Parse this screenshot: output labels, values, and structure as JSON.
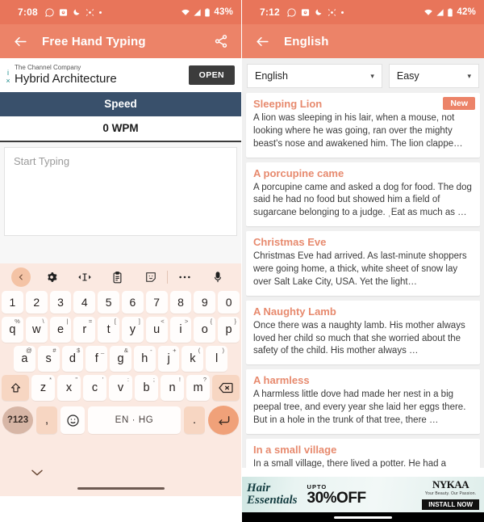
{
  "left": {
    "status": {
      "time": "7:08",
      "battery": "43%",
      "icons": [
        "whatsapp-icon",
        "camera-icon",
        "moon-dnd-icon",
        "location-icon",
        "dot-icon"
      ],
      "right_icons": [
        "wifi-icon",
        "signal-icon",
        "battery-icon"
      ]
    },
    "appbar": {
      "title": "Free Hand Typing",
      "back": "back-arrow",
      "share": "share-icon"
    },
    "ad": {
      "advertiser": "The Channel Company",
      "headline": "Hybrid Architecture",
      "cta": "OPEN",
      "info": "i",
      "close": "×"
    },
    "speed": {
      "label": "Speed",
      "value": "0 WPM"
    },
    "editor": {
      "placeholder": "Start Typing",
      "value": ""
    },
    "keyboard": {
      "tools": [
        "chevron-left-icon",
        "gear-icon",
        "text-cursor-icon",
        "clipboard-icon",
        "sticker-icon",
        "more-icon",
        "mic-icon"
      ],
      "row_numbers": [
        "1",
        "2",
        "3",
        "4",
        "5",
        "6",
        "7",
        "8",
        "9",
        "0"
      ],
      "row_q": [
        {
          "k": "q",
          "s": "%"
        },
        {
          "k": "w",
          "s": "\\"
        },
        {
          "k": "e",
          "s": "|"
        },
        {
          "k": "r",
          "s": "="
        },
        {
          "k": "t",
          "s": "["
        },
        {
          "k": "y",
          "s": "]"
        },
        {
          "k": "u",
          "s": "<"
        },
        {
          "k": "i",
          "s": ">"
        },
        {
          "k": "o",
          "s": "{"
        },
        {
          "k": "p",
          "s": "}"
        }
      ],
      "row_a": [
        {
          "k": "a",
          "s": "@"
        },
        {
          "k": "s",
          "s": "#"
        },
        {
          "k": "d",
          "s": "$"
        },
        {
          "k": "f",
          "s": "_"
        },
        {
          "k": "g",
          "s": "&"
        },
        {
          "k": "h",
          "s": "-"
        },
        {
          "k": "j",
          "s": "+"
        },
        {
          "k": "k",
          "s": "("
        },
        {
          "k": "l",
          "s": ")"
        }
      ],
      "row_z": [
        {
          "k": "z",
          "s": "*"
        },
        {
          "k": "x",
          "s": "\""
        },
        {
          "k": "c",
          "s": "'"
        },
        {
          "k": "v",
          "s": ":"
        },
        {
          "k": "b",
          "s": ";"
        },
        {
          "k": "n",
          "s": "!"
        },
        {
          "k": "m",
          "s": "?"
        }
      ],
      "shift": "shift-icon",
      "backspace": "backspace-icon",
      "sym": "?123",
      "comma": ",",
      "emoji": "emoji-icon",
      "space": "EN · HG",
      "period": ".",
      "enter": "enter-icon",
      "collapse": "chevron-down-icon"
    }
  },
  "right": {
    "status": {
      "time": "7:12",
      "battery": "42%",
      "icons": [
        "whatsapp-icon",
        "camera-icon",
        "moon-dnd-icon",
        "location-icon",
        "dot-icon"
      ],
      "right_icons": [
        "wifi-icon",
        "signal-icon",
        "battery-icon"
      ]
    },
    "appbar": {
      "title": "English",
      "back": "back-arrow"
    },
    "selectors": {
      "language": {
        "value": "English",
        "caret": "▾"
      },
      "difficulty": {
        "value": "Easy",
        "caret": "▾"
      }
    },
    "new_badge": "New",
    "stories": [
      {
        "title": "Sleeping Lion",
        "body": "A lion was sleeping in his lair, when a mouse, not looking where he was going, ran over the mighty beast's nose and awakened him. The lion clappe…",
        "badge": "New"
      },
      {
        "title": "A porcupine came",
        "body": "A porcupine came and asked a dog for food. The dog said he had no food but showed him a field of sugarcane belonging to a judge. ˌEat as much as …",
        "badge": ""
      },
      {
        "title": "Christmas Eve",
        "body": "Christmas Eve had arrived. As last-minute shoppers were going home, a thick, white sheet of snow lay over Salt Lake City, USA. Yet the light…",
        "badge": ""
      },
      {
        "title": "A Naughty Lamb",
        "body": "Once there was a naughty lamb. His mother always loved her child so much that she worried about the safety of the child. His mother always …",
        "badge": ""
      },
      {
        "title": "A harmless",
        "body": "A harmless little dove had made her nest in a big peepal tree, and every year she laid her eggs there. But in a hole in the trunk of that tree, there …",
        "badge": ""
      },
      {
        "title": "In a small village",
        "body": "In a small village, there lived a potter. He had a donkey. Everyday his donkey would carry soil from the field to his house. Since the field was qu…",
        "badge": ""
      }
    ],
    "bottom_ad": {
      "line1": "Hair",
      "line2": "Essentials",
      "upto": "UPTO",
      "discount": "30%OFF",
      "brand": "NYKAA",
      "tagline": "Your Beauty. Our Passion.",
      "cta": "INSTALL NOW"
    }
  },
  "colors": {
    "status_bar": "#e8755a",
    "app_bar": "#ec8368",
    "speed_header": "#39506b",
    "accent_title": "#e78a6e",
    "keyboard_bg": "#fbe9e1"
  }
}
